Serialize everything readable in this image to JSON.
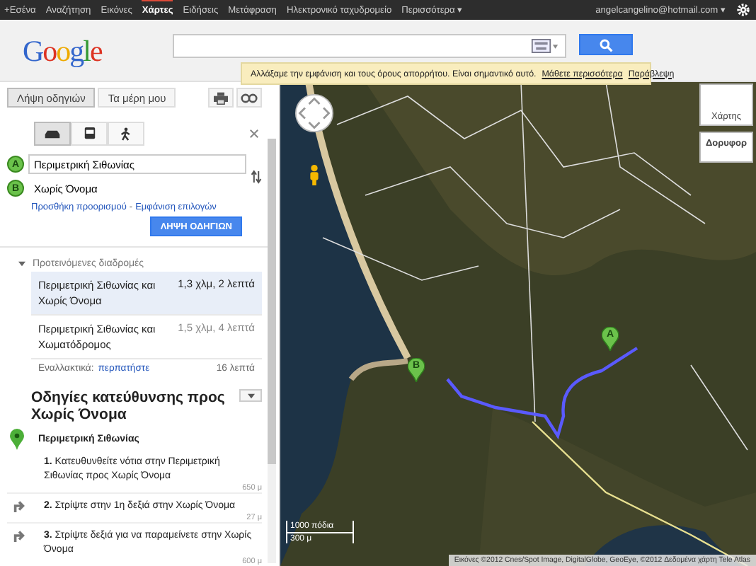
{
  "top_nav": {
    "items": [
      {
        "label": "+Εσένα",
        "selected": false
      },
      {
        "label": "Αναζήτηση",
        "selected": false
      },
      {
        "label": "Εικόνες",
        "selected": false
      },
      {
        "label": "Χάρτες",
        "selected": true
      },
      {
        "label": "Ειδήσεις",
        "selected": false
      },
      {
        "label": "Μετάφραση",
        "selected": false
      },
      {
        "label": "Ηλεκτρονικό ταχυδρομείο",
        "selected": false
      },
      {
        "label": "Περισσότερα ▾",
        "selected": false
      }
    ],
    "account": "angelcangelino@hotmail.com ▾"
  },
  "logo": "Google",
  "notice": {
    "text": "Αλλάξαμε την εμφάνιση και τους όρους απορρήτου. Είναι σημαντικό αυτό.",
    "links": [
      "Μάθετε περισσότερα",
      "Παράβλεψη"
    ]
  },
  "panel": {
    "tabs": [
      {
        "label": "Λήψη οδηγιών",
        "selected": true
      },
      {
        "label": "Τα μέρη μου",
        "selected": false
      }
    ],
    "modes": [
      {
        "kind": "car",
        "selected": true
      },
      {
        "kind": "bus",
        "selected": false
      },
      {
        "kind": "walk",
        "selected": false
      }
    ],
    "waypoints": [
      {
        "letter": "A",
        "value": "Περιμετρική Σιθωνίας"
      },
      {
        "letter": "B",
        "value": "Χωρίς Όνομα"
      }
    ],
    "links": [
      "Προσθήκη προορισμού",
      "Εμφάνιση επιλογών"
    ],
    "link_separator": "-",
    "submit": "ΛΗΨΗ ΟΔΗΓΙΩΝ",
    "suggested": {
      "title": "Προτεινόμενες διαδρομές",
      "expanded": true,
      "routes": [
        {
          "name": "Περιμετρική Σιθωνίας και Χωρίς Όνομα",
          "info": "1,3 χλμ, 2 λεπτά",
          "selected": true
        },
        {
          "name": "Περιμετρική Σιθωνίας και Χωματόδρομος",
          "info": "1,5 χλμ, 4 λεπτά",
          "selected": false
        }
      ],
      "alternative": {
        "label": "Εναλλακτικά:",
        "link": "περπατήστε",
        "info": "16 λεπτά"
      }
    },
    "directions": {
      "title": "Οδηγίες κατεύθυνσης προς Χωρίς Όνομα",
      "start": "Περιμετρική Σιθωνίας",
      "steps": [
        {
          "num": "1.",
          "text": "Κατευθυνθείτε νότια στην Περιμετρική Σιθωνίας προς Χωρίς Όνομα",
          "distance": "650 μ",
          "kind": "start"
        },
        {
          "num": "2.",
          "text": "Στρίψτε στην 1η δεξιά στην Χωρίς Όνομα",
          "distance": "27 μ",
          "kind": "right"
        },
        {
          "num": "3.",
          "text": "Στρίψτε δεξιά για να παραμείνετε στην Χωρίς Όνομα",
          "distance": "600 μ",
          "kind": "right"
        }
      ]
    }
  },
  "map": {
    "types": [
      {
        "label": "Χάρτης",
        "selected": false
      },
      {
        "label": "Δορυφορ",
        "selected": true
      }
    ],
    "markers": [
      "A",
      "B"
    ],
    "scale": [
      "1000 πόδια",
      "300 μ"
    ],
    "attribution": "Εικόνες ©2012 Cnes/Spot Image, DigitalGlobe, GeoEye, ©2012 Δεδομένα χάρτη Tele Atlas"
  }
}
